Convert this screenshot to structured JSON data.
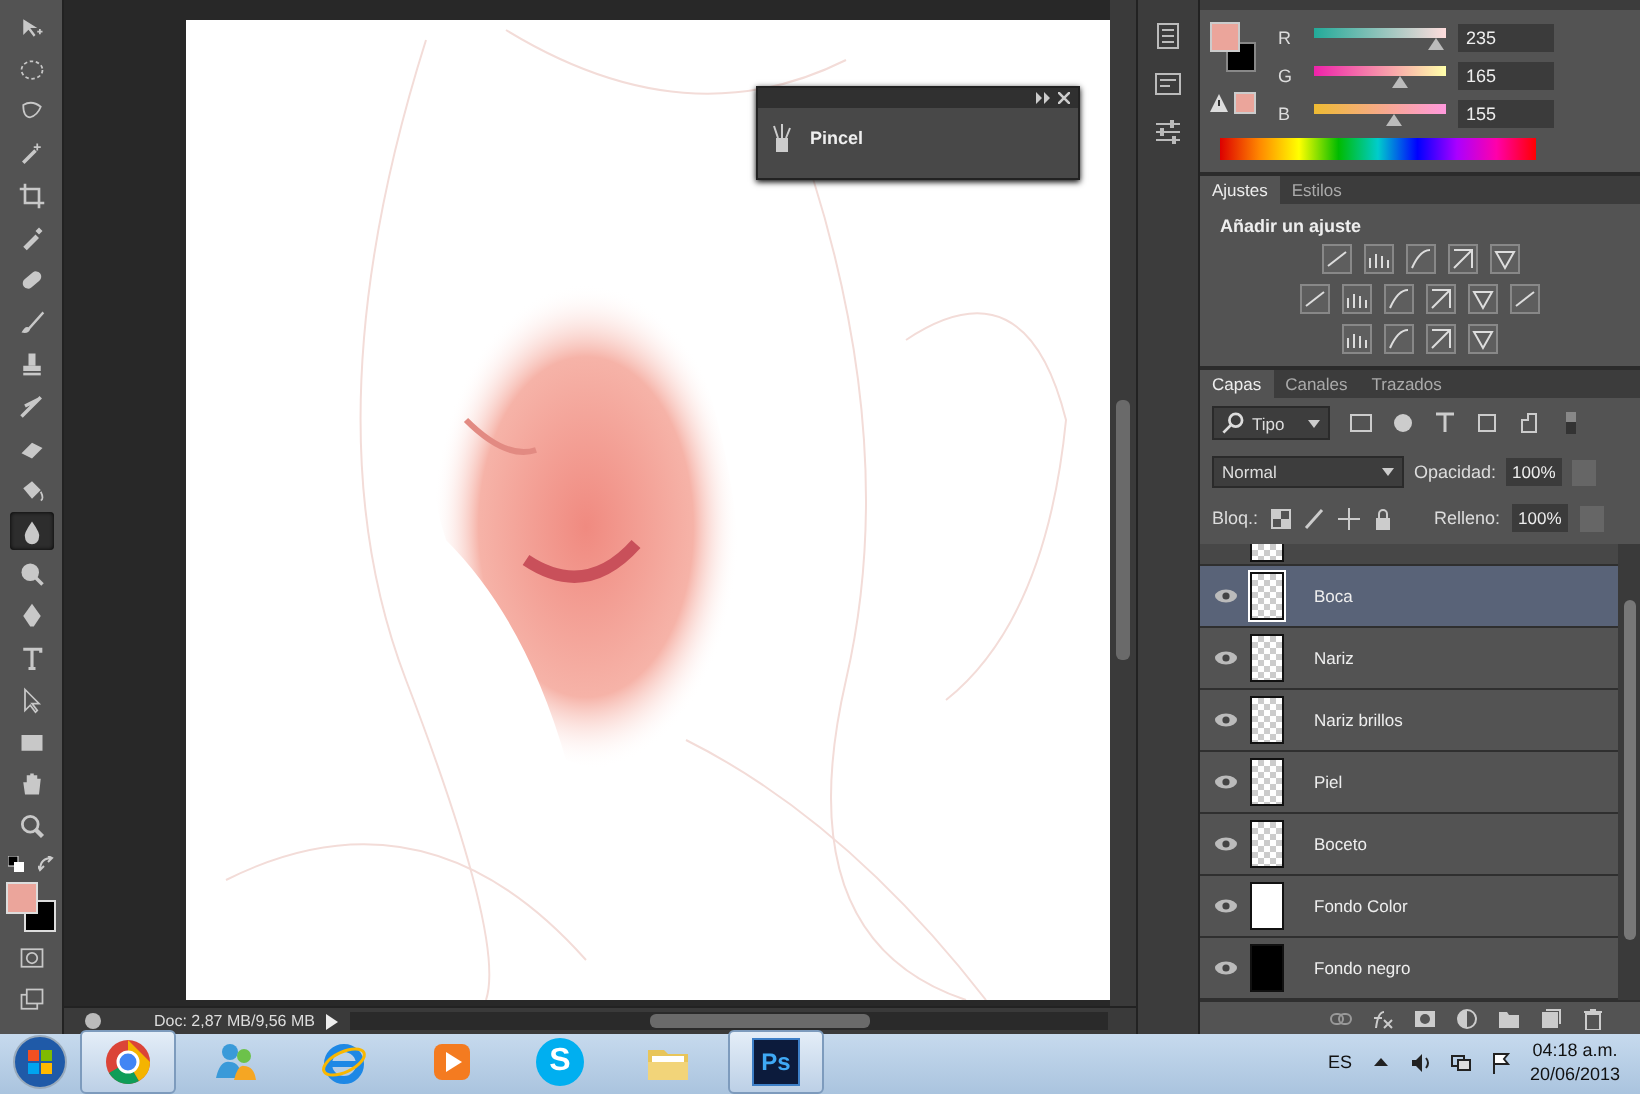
{
  "tools": [
    {
      "selected": false
    },
    {
      "selected": false
    },
    {
      "selected": false
    },
    {
      "selected": false
    },
    {
      "selected": false
    },
    {
      "selected": false
    },
    {
      "selected": false
    },
    {
      "selected": false
    },
    {
      "selected": false
    },
    {
      "selected": false
    },
    {
      "selected": false
    },
    {
      "selected": false
    },
    {
      "selected": true
    },
    {
      "selected": false
    },
    {
      "selected": false
    },
    {
      "selected": false
    },
    {
      "selected": false
    },
    {
      "selected": false
    },
    {
      "selected": false
    },
    {
      "selected": false
    }
  ],
  "floating_panel": {
    "label": "Pincel"
  },
  "status_bar": {
    "doc": "Doc: 2,87 MB/9,56 MB"
  },
  "color_panel": {
    "channels": [
      {
        "label": "R",
        "value": "235",
        "level": 0.92
      },
      {
        "label": "G",
        "value": "165",
        "level": 0.65
      },
      {
        "label": "B",
        "value": "155",
        "level": 0.61
      }
    ]
  },
  "adjustments_panel": {
    "tabs": [
      {
        "label": "Ajustes",
        "selected": true
      },
      {
        "label": "Estilos",
        "selected": false
      }
    ],
    "heading": "Añadir un ajuste"
  },
  "layers_panel": {
    "tabs": [
      {
        "label": "Capas",
        "selected": true
      },
      {
        "label": "Canales",
        "selected": false
      },
      {
        "label": "Trazados",
        "selected": false
      }
    ],
    "filter": "Tipo",
    "blend_mode": "Normal",
    "opacity_label": "Opacidad:",
    "opacity": "100%",
    "lock_label": "Bloq.:",
    "fill_label": "Relleno:",
    "fill": "100%",
    "layers": [
      {
        "name": "Boca",
        "visible": true,
        "selected": true,
        "kind": "transparent"
      },
      {
        "name": "Nariz",
        "visible": true,
        "selected": false,
        "kind": "transparent"
      },
      {
        "name": "Nariz brillos",
        "visible": true,
        "selected": false,
        "kind": "transparent"
      },
      {
        "name": "Piel",
        "visible": true,
        "selected": false,
        "kind": "transparent"
      },
      {
        "name": "Boceto",
        "visible": true,
        "selected": false,
        "kind": "transparent"
      },
      {
        "name": "Fondo Color",
        "visible": true,
        "selected": false,
        "kind": "white"
      },
      {
        "name": "Fondo negro",
        "visible": true,
        "selected": false,
        "kind": "black"
      }
    ]
  },
  "taskbar": {
    "apps": [
      {
        "kind": "browser",
        "running": true
      },
      {
        "kind": "messenger",
        "running": false
      },
      {
        "kind": "internet",
        "running": false
      },
      {
        "kind": "media",
        "running": false
      },
      {
        "kind": "chat",
        "running": false,
        "label": "S"
      },
      {
        "kind": "folder",
        "running": false
      },
      {
        "kind": "photoshop",
        "running": true,
        "label": "Ps"
      }
    ],
    "language": "ES",
    "time": "04:18 a.m.",
    "date": "20/06/2013"
  }
}
